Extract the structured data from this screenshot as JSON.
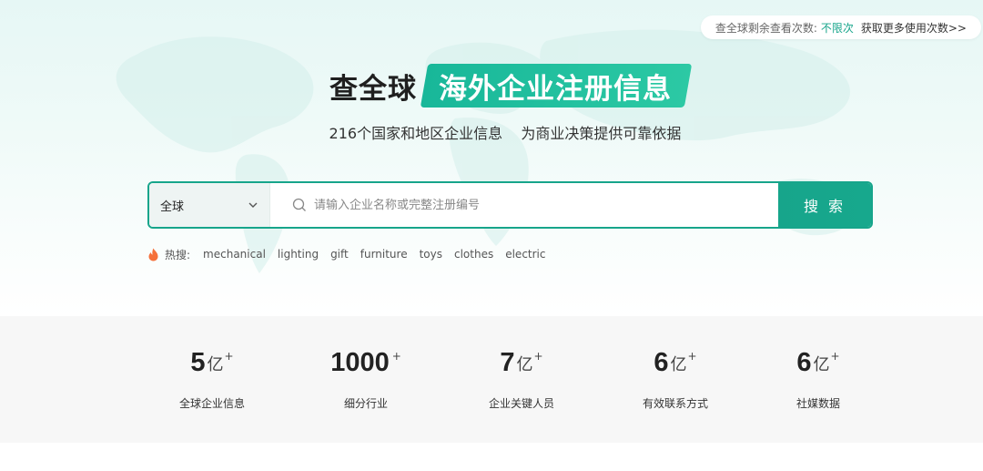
{
  "quota": {
    "label": "查全球剩余查看次数:",
    "value": "不限次",
    "link": "获取更多使用次数>>"
  },
  "hero": {
    "brand": "查全球",
    "tagline": "海外企业注册信息",
    "subtitle": "216个国家和地区企业信息    为商业决策提供可靠依据"
  },
  "search": {
    "region": "全球",
    "placeholder": "请输入企业名称或完整注册编号",
    "button": "搜 索"
  },
  "hot": {
    "label": "热搜:",
    "keywords": [
      "mechanical",
      "lighting",
      "gift",
      "furniture",
      "toys",
      "clothes",
      "electric"
    ]
  },
  "stats": [
    {
      "number": "5",
      "unit": "亿",
      "plus": "+",
      "label": "全球企业信息"
    },
    {
      "number": "1000",
      "unit": "",
      "plus": "+",
      "label": "细分行业"
    },
    {
      "number": "7",
      "unit": "亿",
      "plus": "+",
      "label": "企业关键人员"
    },
    {
      "number": "6",
      "unit": "亿",
      "plus": "+",
      "label": "有效联系方式"
    },
    {
      "number": "6",
      "unit": "亿",
      "plus": "+",
      "label": "社媒数据"
    }
  ],
  "colors": {
    "accent": "#17a58b",
    "hot_icon": "#f5703a",
    "stats_bg": "#f7f7f7"
  }
}
